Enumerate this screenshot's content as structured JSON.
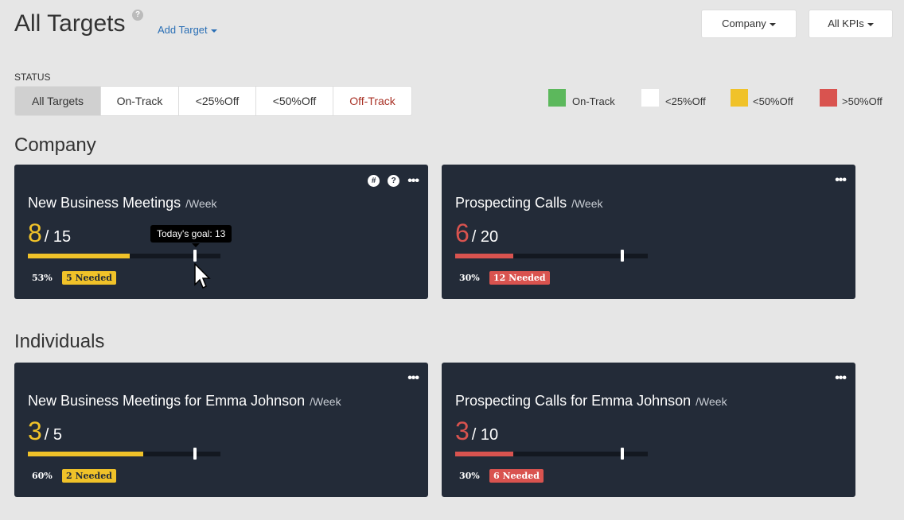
{
  "header": {
    "title": "All Targets",
    "help_icon": "question-circle-icon",
    "add_target_label": "Add Target",
    "company_dropdown": "Company",
    "kpis_dropdown": "All KPIs"
  },
  "status": {
    "label": "STATUS",
    "buttons": [
      {
        "label": "All Targets",
        "active": true,
        "color": "#333333"
      },
      {
        "label": "On-Track",
        "active": false,
        "color": "#333333"
      },
      {
        "label": "<25%Off",
        "active": false,
        "color": "#333333"
      },
      {
        "label": "<50%Off",
        "active": false,
        "color": "#333333"
      },
      {
        "label": "Off-Track",
        "active": false,
        "color": "#a93226"
      }
    ]
  },
  "legend": [
    {
      "label": "On-Track",
      "color": "#5cb85c"
    },
    {
      "label": "<25%Off",
      "color": "#ffffff"
    },
    {
      "label": "<50%Off",
      "color": "#f0c229"
    },
    {
      "label": ">50%Off",
      "color": "#d9534f"
    }
  ],
  "sections": {
    "company": "Company",
    "individuals": "Individuals"
  },
  "cards": [
    {
      "title": "New Business Meetings",
      "unit": "/Week",
      "actual": "8",
      "target": "15",
      "progress": 0.53,
      "goal_fraction": 0.867,
      "percent": "53%",
      "needed": "5 Needed",
      "status_color": "#f0c229",
      "badge_text_color": "#232b38",
      "icons": [
        "hash-icon",
        "help-icon",
        "more-icon"
      ]
    },
    {
      "title": "Prospecting Calls",
      "unit": "/Week",
      "actual": "6",
      "target": "20",
      "progress": 0.3,
      "goal_fraction": 0.867,
      "percent": "30%",
      "needed": "12 Needed",
      "status_color": "#d9534f",
      "badge_text_color": "#ffffff",
      "icons": [
        "more-icon"
      ]
    },
    {
      "title": "New Business Meetings for Emma Johnson",
      "unit": "/Week",
      "actual": "3",
      "target": "5",
      "progress": 0.6,
      "goal_fraction": 0.867,
      "percent": "60%",
      "needed": "2 Needed",
      "status_color": "#f0c229",
      "badge_text_color": "#232b38",
      "icons": [
        "more-icon"
      ]
    },
    {
      "title": "Prospecting Calls for Emma Johnson",
      "unit": "/Week",
      "actual": "3",
      "target": "10",
      "progress": 0.3,
      "goal_fraction": 0.867,
      "percent": "30%",
      "needed": "6 Needed",
      "status_color": "#d9534f",
      "badge_text_color": "#ffffff",
      "icons": [
        "more-icon"
      ]
    }
  ],
  "tooltip": "Today's goal: 13",
  "colors": {
    "background": "#e6e6e6",
    "card_background": "#232b38",
    "link": "#2a6fb5"
  }
}
